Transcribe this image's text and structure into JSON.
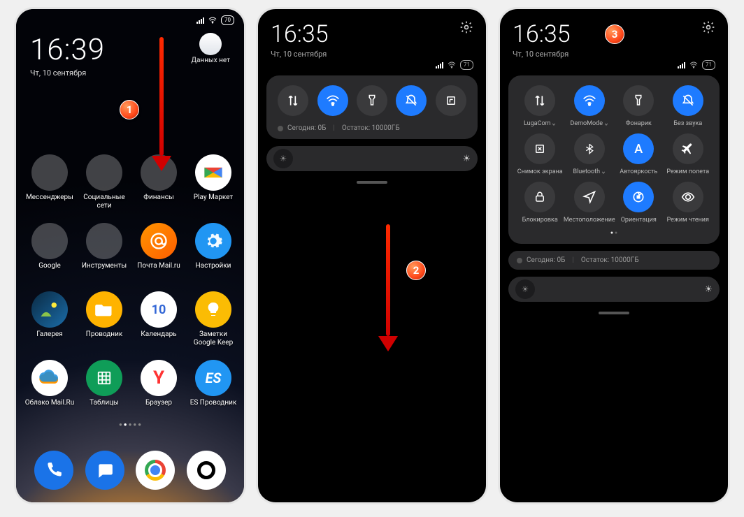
{
  "panel1": {
    "status": {
      "battery": "70"
    },
    "clock": "16:39",
    "date": "Чт, 10 сентября",
    "weather_label": "Данных нет",
    "apps": [
      "Мессенджеры",
      "Социальные сети",
      "Финансы",
      "Play Маркет",
      "Google",
      "Инструменты",
      "Почта Mail.ru",
      "Настройки",
      "Галерея",
      "Проводник",
      "Календарь",
      "Заметки Google Keep",
      "Облако Mail.Ru",
      "Таблицы",
      "Браузер",
      "ES Проводник"
    ],
    "calendar_day": "10",
    "step": "1"
  },
  "panel2": {
    "clock": "16:35",
    "date": "Чт, 10 сентября",
    "battery": "71",
    "usage_today": "Сегодня: 0Б",
    "usage_remain": "Остаток: 10000ГБ",
    "step": "2"
  },
  "panel3": {
    "clock": "16:35",
    "date": "Чт, 10 сентября",
    "battery": "71",
    "tiles": [
      {
        "label": "LugaCom",
        "on": false,
        "icon": "data",
        "sub": true
      },
      {
        "label": "DemoMode",
        "on": true,
        "icon": "wifi",
        "sub": true
      },
      {
        "label": "Фонарик",
        "on": false,
        "icon": "flash"
      },
      {
        "label": "Без звука",
        "on": true,
        "icon": "mute"
      },
      {
        "label": "Снимок экрана",
        "on": false,
        "icon": "shot"
      },
      {
        "label": "Bluetooth",
        "on": false,
        "icon": "bt",
        "sub": true
      },
      {
        "label": "Автояркость",
        "on": true,
        "icon": "auto"
      },
      {
        "label": "Режим полета",
        "on": false,
        "icon": "plane"
      },
      {
        "label": "Блокировка",
        "on": false,
        "icon": "lock"
      },
      {
        "label": "Местоположение",
        "on": false,
        "icon": "loc"
      },
      {
        "label": "Ориентация",
        "on": true,
        "icon": "rotate"
      },
      {
        "label": "Режим чтения",
        "on": false,
        "icon": "read"
      }
    ],
    "usage_today": "Сегодня: 0Б",
    "usage_remain": "Остаток: 10000ГБ",
    "step": "3"
  }
}
